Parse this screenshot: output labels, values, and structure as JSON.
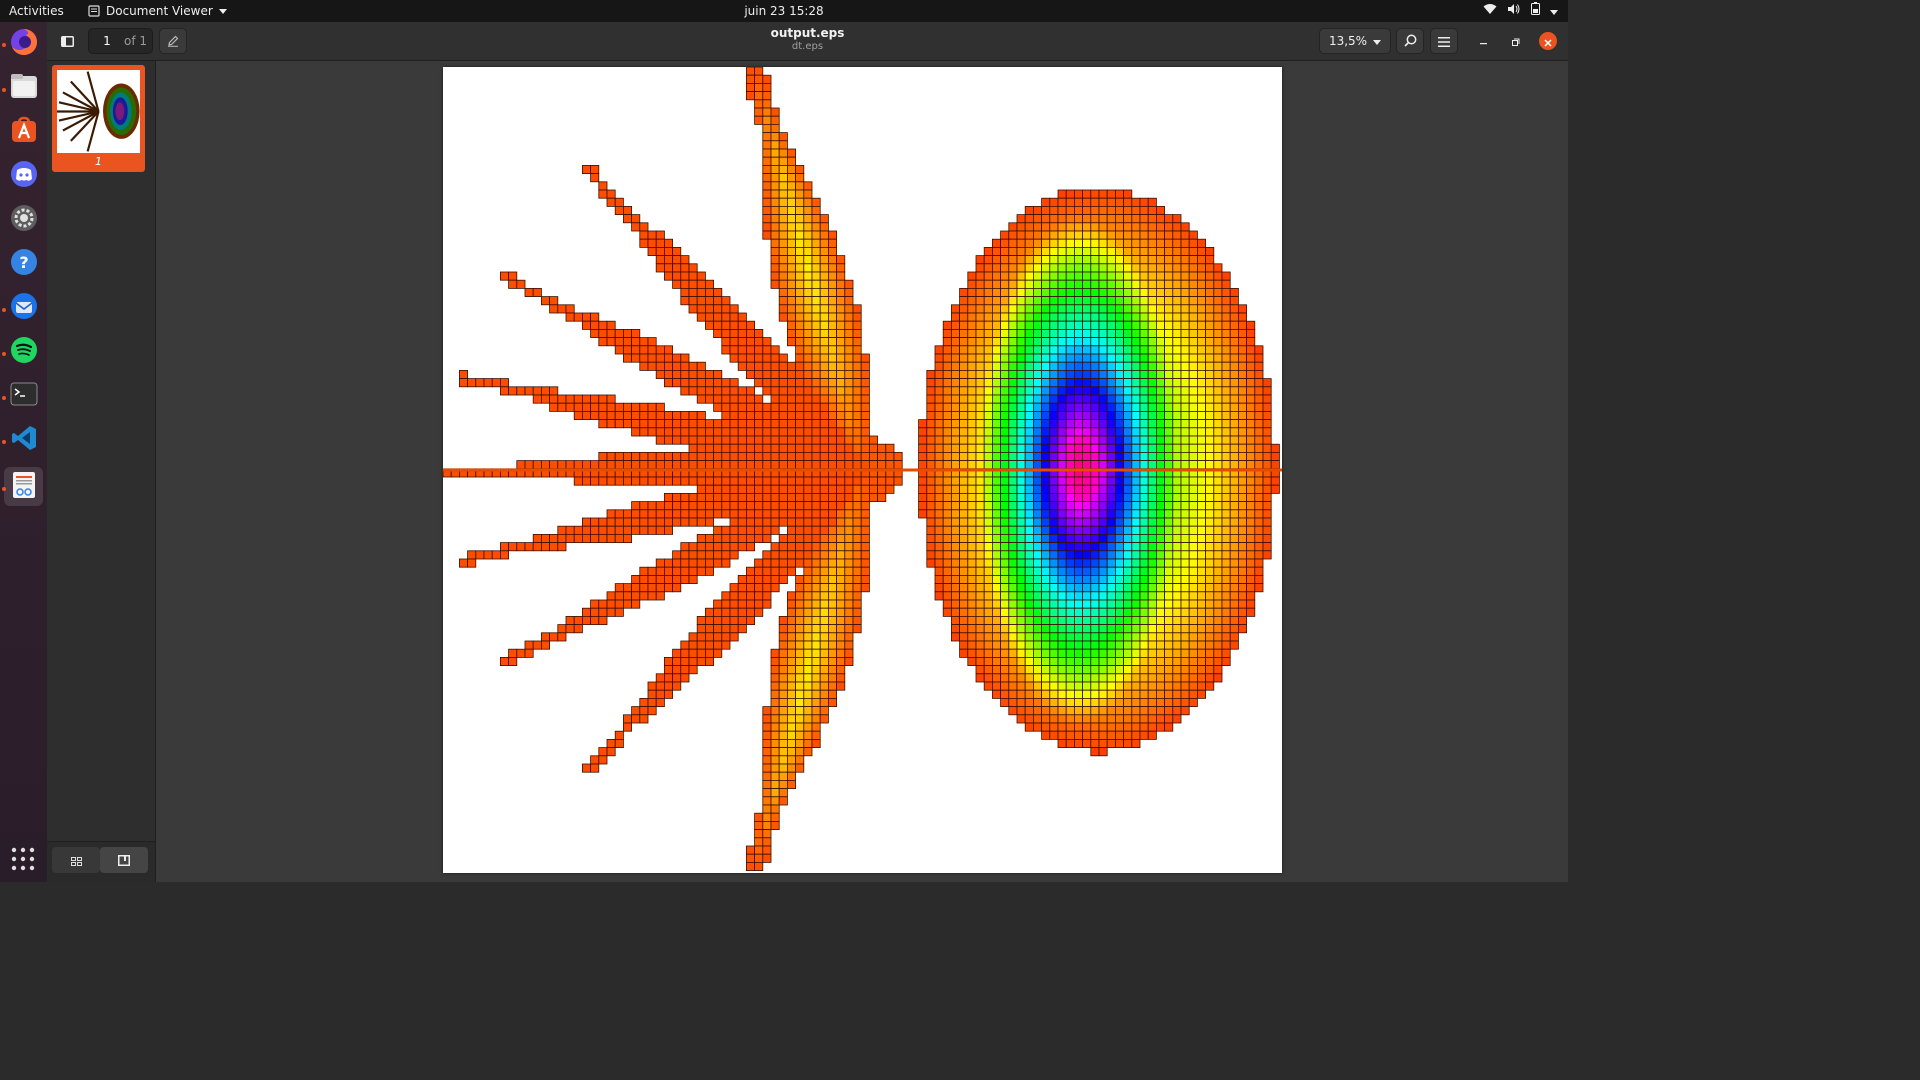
{
  "topbar": {
    "activities": "Activities",
    "app_name": "Document Viewer",
    "clock": "juin 23  15:28"
  },
  "dock": {
    "apps": [
      {
        "name": "firefox-icon",
        "running": true
      },
      {
        "name": "files-icon",
        "running": true
      },
      {
        "name": "app-center-icon",
        "running": false
      },
      {
        "name": "discord-icon",
        "running": false
      },
      {
        "name": "settings-icon",
        "running": false
      },
      {
        "name": "help-icon",
        "running": false
      },
      {
        "name": "thunderbird-icon",
        "running": true
      },
      {
        "name": "spotify-icon",
        "running": true
      },
      {
        "name": "terminal-icon",
        "running": true
      },
      {
        "name": "vscode-icon",
        "running": true
      },
      {
        "name": "document-viewer-icon",
        "running": true
      }
    ]
  },
  "header": {
    "page_current": "1",
    "page_total": "of 1",
    "title": "output.eps",
    "subtitle": "dt.eps",
    "zoom": "13,5%"
  },
  "sidebar": {
    "pages": [
      {
        "label": "1",
        "selected": true
      }
    ]
  },
  "colors": {
    "accent": "#e95420",
    "cell_border": "#3a1000"
  }
}
